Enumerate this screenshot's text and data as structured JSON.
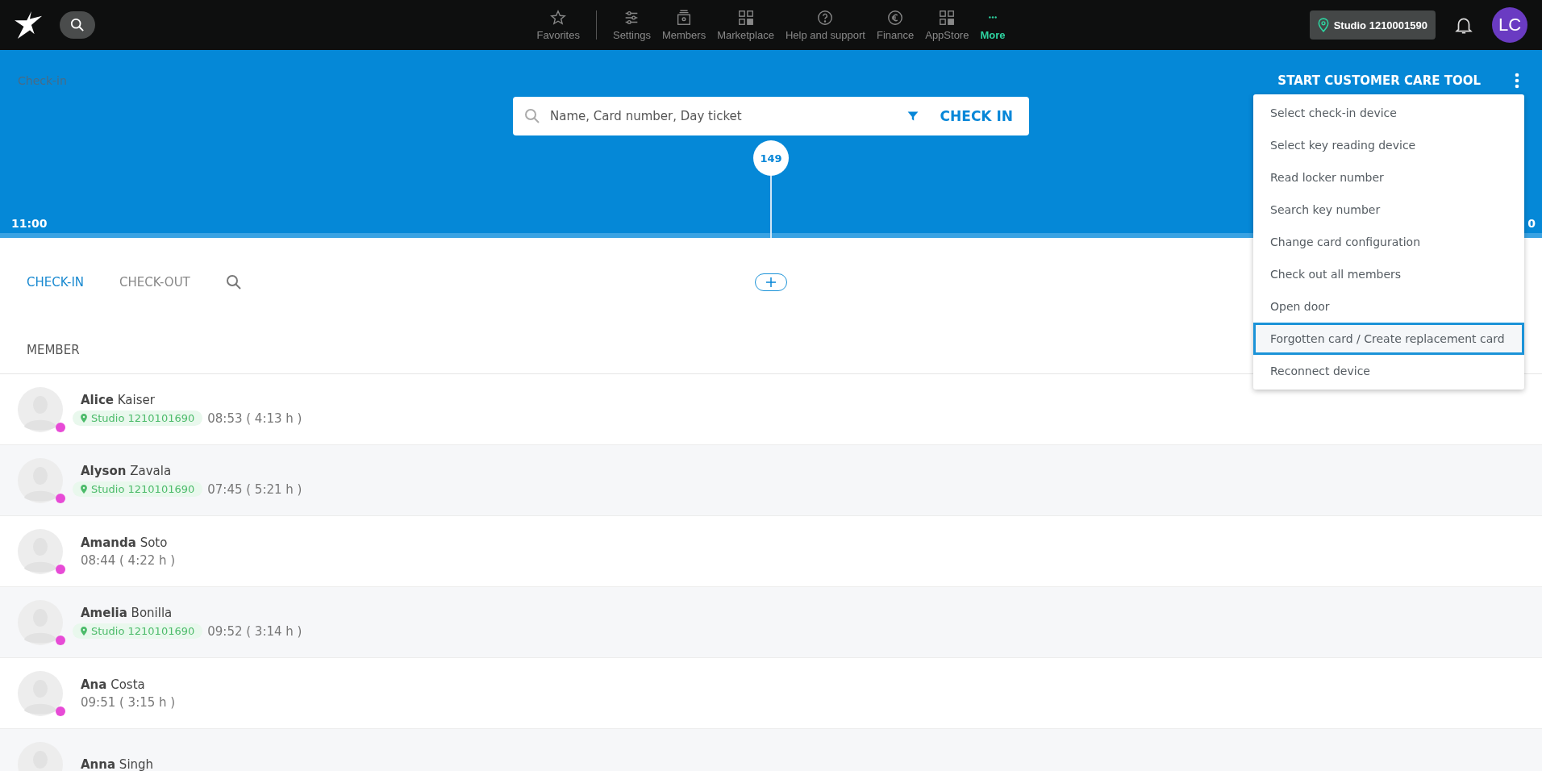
{
  "top_nav": {
    "items": [
      {
        "label": "Favorites",
        "selected": false
      },
      {
        "label": "Settings",
        "selected": false
      },
      {
        "label": "Members",
        "selected": false
      },
      {
        "label": "Marketplace",
        "selected": false
      },
      {
        "label": "Help and support",
        "selected": false
      },
      {
        "label": "Finance",
        "selected": false
      },
      {
        "label": "AppStore",
        "selected": false
      },
      {
        "label": "More",
        "selected": true
      }
    ],
    "studio": "Studio 1210001590",
    "avatar": "LC"
  },
  "page": {
    "breadcrumb": "Check-in",
    "care_tool": "START CUSTOMER CARE TOOL",
    "search": {
      "placeholder": "Name, Card number, Day ticket"
    },
    "check_in_button": "CHECK IN"
  },
  "timeline": {
    "count": "149",
    "start": "11:00",
    "end": "0"
  },
  "tabs": [
    {
      "label": "CHECK-IN",
      "selected": true
    },
    {
      "label": "CHECK-OUT",
      "selected": false
    }
  ],
  "table": {
    "column": "MEMBER",
    "rows": [
      {
        "first": "Alice",
        "last": "Kaiser",
        "studio": "Studio 1210101690",
        "time": "08:53 ( 4:13 h )"
      },
      {
        "first": "Alyson",
        "last": "Zavala",
        "studio": "Studio 1210101690",
        "time": "07:45 ( 5:21 h )"
      },
      {
        "first": "Amanda",
        "last": "Soto",
        "time": "08:44 ( 4:22 h )"
      },
      {
        "first": "Amelia",
        "last": "Bonilla",
        "studio": "Studio 1210101690",
        "time": "09:52 ( 3:14 h )"
      },
      {
        "first": "Ana",
        "last": "Costa",
        "time": "09:51 ( 3:15 h )"
      },
      {
        "first": "Anna",
        "last": "Singh"
      }
    ]
  },
  "menu": {
    "items": [
      {
        "label": "Select check-in device",
        "selected": false
      },
      {
        "label": "Select key reading device",
        "selected": false
      },
      {
        "label": "Read locker number",
        "selected": false
      },
      {
        "label": "Search key number",
        "selected": false
      },
      {
        "label": "Change card configuration",
        "selected": false
      },
      {
        "label": "Check out all members",
        "selected": false
      },
      {
        "label": "Open door",
        "selected": false
      },
      {
        "label": "Forgotten card / Create replacement card",
        "selected": true
      },
      {
        "label": "Reconnect device",
        "selected": false
      }
    ]
  }
}
